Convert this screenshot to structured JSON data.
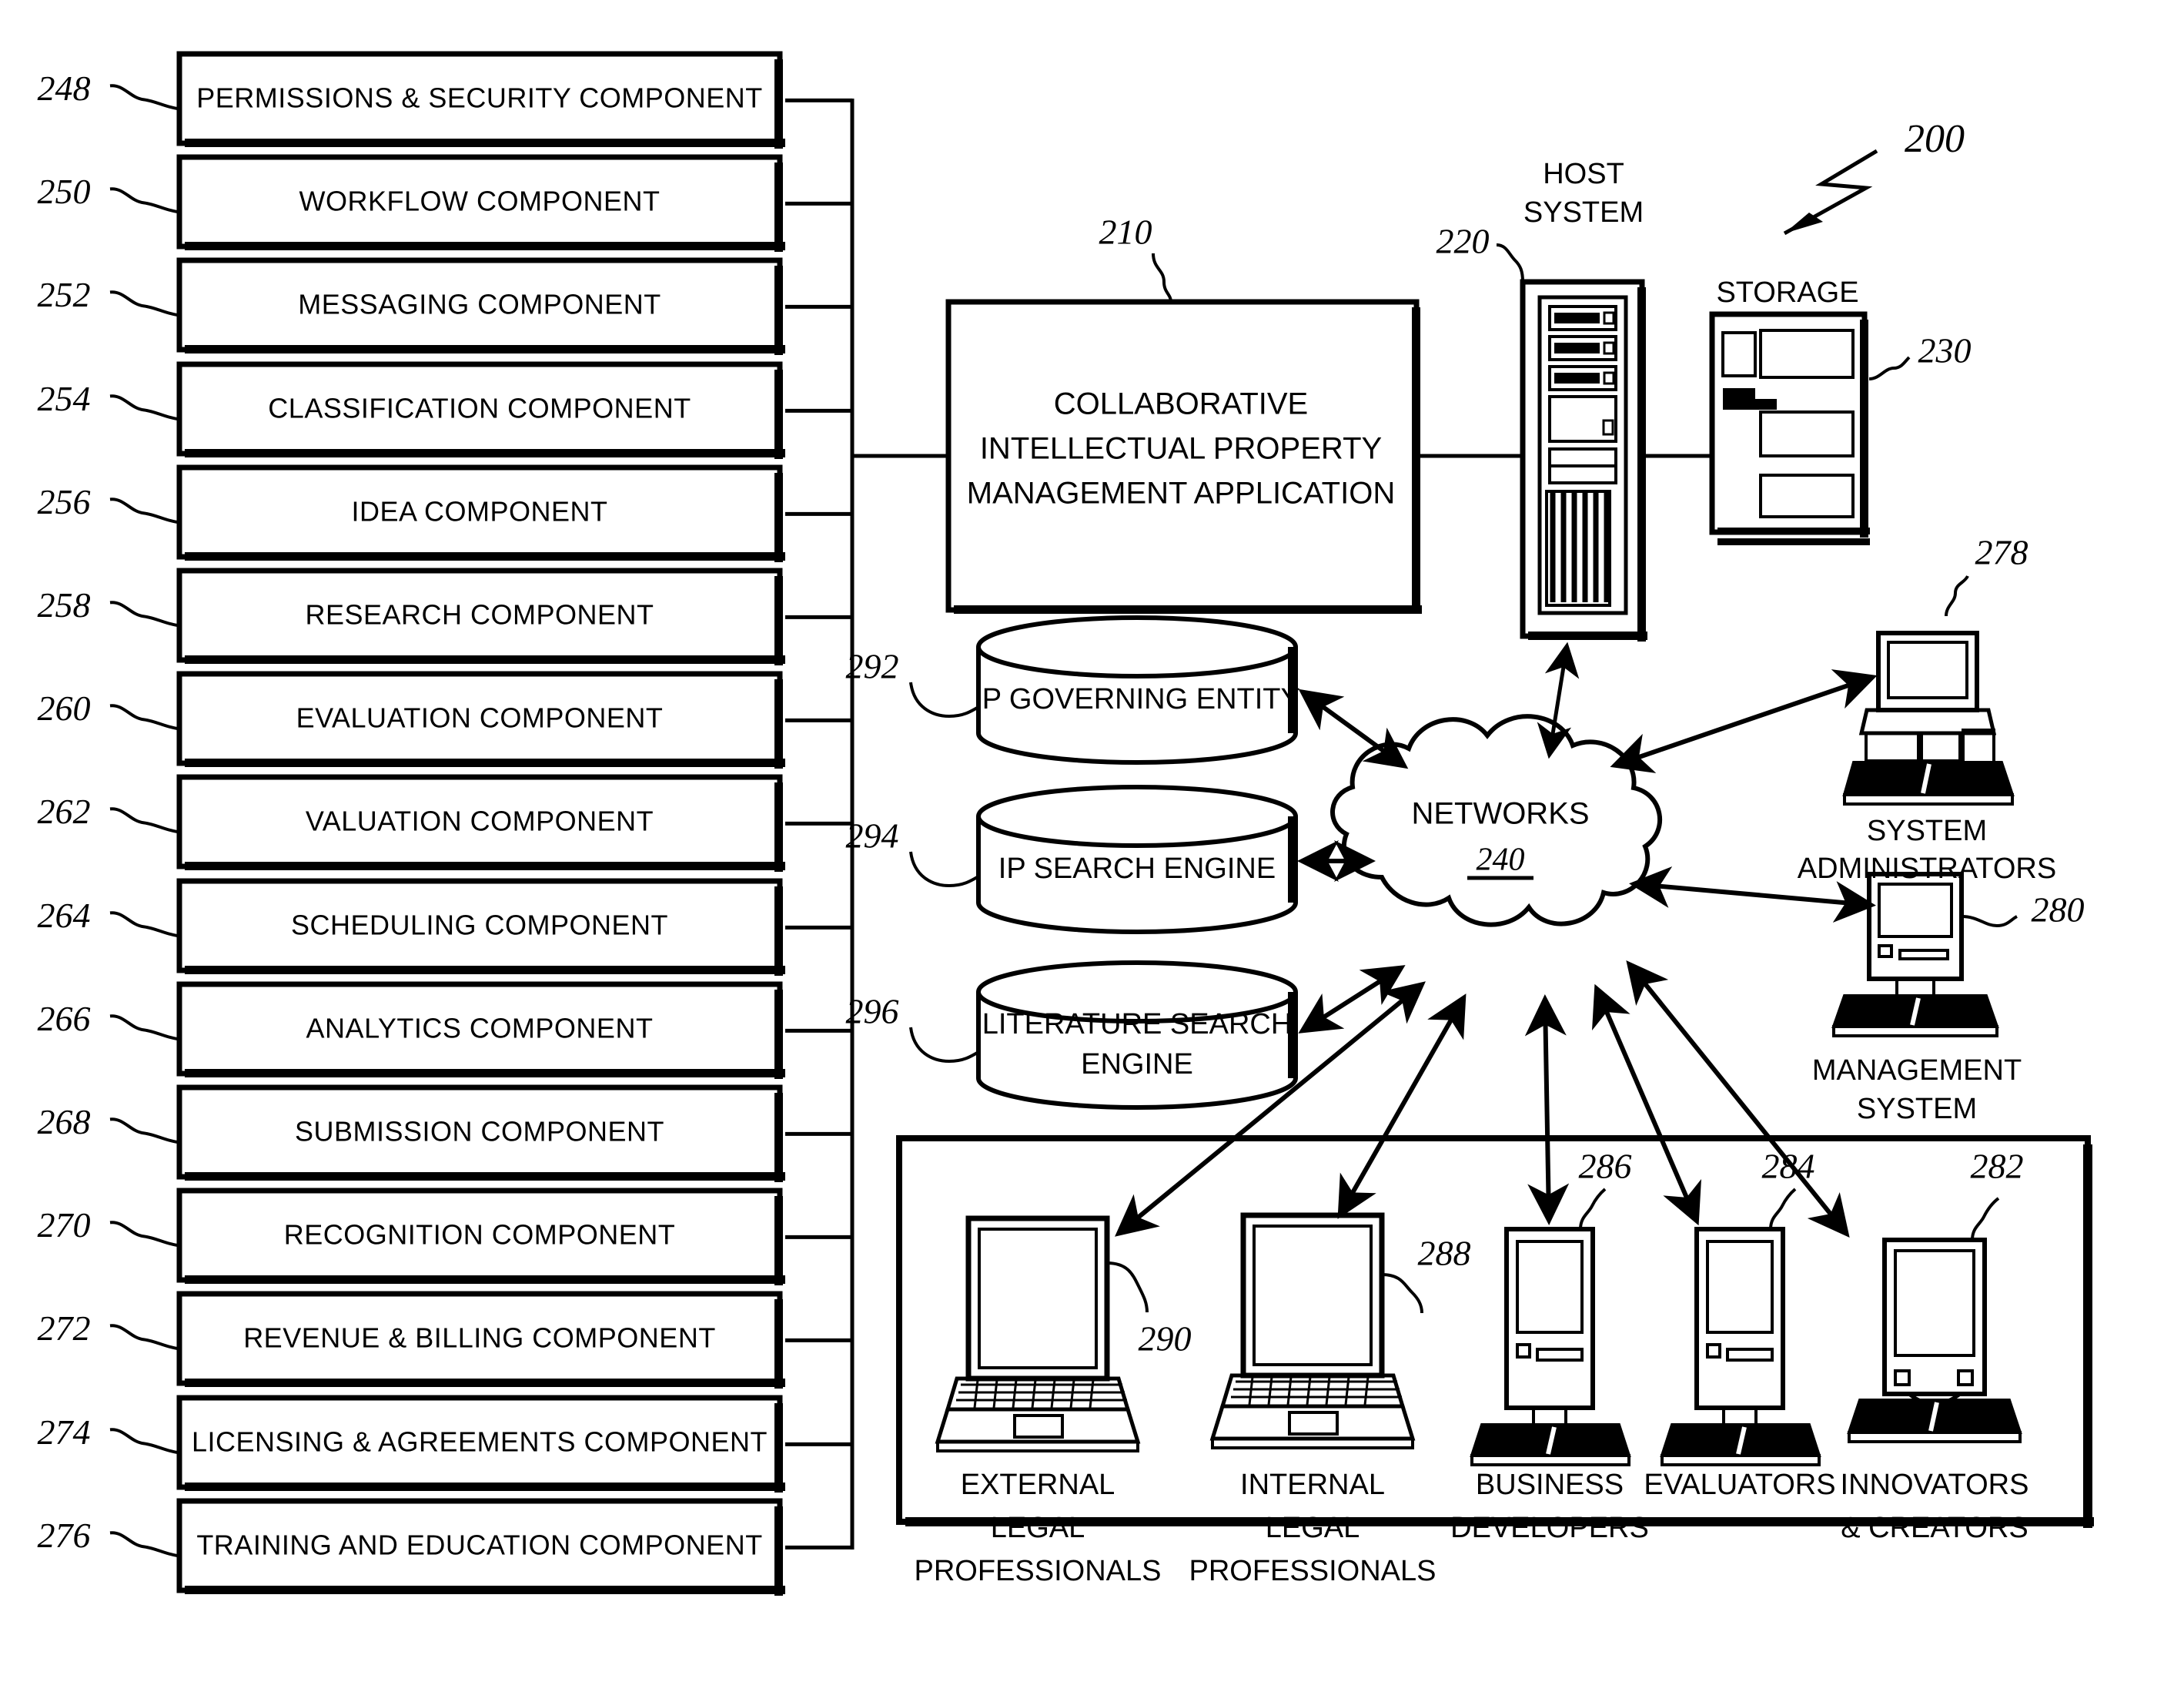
{
  "figure": {
    "system_ref": "200",
    "components": [
      {
        "ref": "248",
        "label": "PERMISSIONS & SECURITY COMPONENT"
      },
      {
        "ref": "250",
        "label": "WORKFLOW COMPONENT"
      },
      {
        "ref": "252",
        "label": "MESSAGING COMPONENT"
      },
      {
        "ref": "254",
        "label": "CLASSIFICATION COMPONENT"
      },
      {
        "ref": "256",
        "label": "IDEA COMPONENT"
      },
      {
        "ref": "258",
        "label": "RESEARCH COMPONENT"
      },
      {
        "ref": "260",
        "label": "EVALUATION COMPONENT"
      },
      {
        "ref": "262",
        "label": "VALUATION COMPONENT"
      },
      {
        "ref": "264",
        "label": "SCHEDULING COMPONENT"
      },
      {
        "ref": "266",
        "label": "ANALYTICS COMPONENT"
      },
      {
        "ref": "268",
        "label": "SUBMISSION COMPONENT"
      },
      {
        "ref": "270",
        "label": "RECOGNITION COMPONENT"
      },
      {
        "ref": "272",
        "label": "REVENUE & BILLING COMPONENT"
      },
      {
        "ref": "274",
        "label": "LICENSING & AGREEMENTS COMPONENT"
      },
      {
        "ref": "276",
        "label": "TRAINING AND EDUCATION COMPONENT"
      }
    ],
    "application": {
      "ref": "210",
      "lines": [
        "COLLABORATIVE",
        "INTELLECTUAL PROPERTY",
        "MANAGEMENT APPLICATION"
      ]
    },
    "host_system": {
      "ref": "220",
      "lines": [
        "HOST",
        "SYSTEM"
      ]
    },
    "storage": {
      "ref": "230",
      "label": "STORAGE"
    },
    "networks": {
      "ref": "240",
      "label": "NETWORKS"
    },
    "cylinders": [
      {
        "ref": "292",
        "lines": [
          "IP GOVERNING ENTITY"
        ]
      },
      {
        "ref": "294",
        "lines": [
          "IP SEARCH ENGINE"
        ]
      },
      {
        "ref": "296",
        "lines": [
          "LITERATURE SEARCH",
          "ENGINE"
        ]
      }
    ],
    "right_nodes": [
      {
        "ref": "278",
        "lines": [
          "SYSTEM",
          "ADMINISTRATORS"
        ]
      },
      {
        "ref": "280",
        "lines": [
          "MANAGEMENT",
          "SYSTEM"
        ]
      }
    ],
    "users": [
      {
        "ref": "290",
        "lines": [
          "EXTERNAL",
          "LEGAL",
          "PROFESSIONALS"
        ]
      },
      {
        "ref": "288",
        "lines": [
          "INTERNAL",
          "LEGAL",
          "PROFESSIONALS"
        ]
      },
      {
        "ref": "286",
        "lines": [
          "BUSINESS",
          "DEVELOPERS"
        ]
      },
      {
        "ref": "284",
        "lines": [
          "EVALUATORS"
        ]
      },
      {
        "ref": "282",
        "lines": [
          "INNOVATORS",
          "& CREATORS"
        ]
      }
    ],
    "colors": {
      "ink": "#000000",
      "paper": "#ffffff"
    }
  }
}
